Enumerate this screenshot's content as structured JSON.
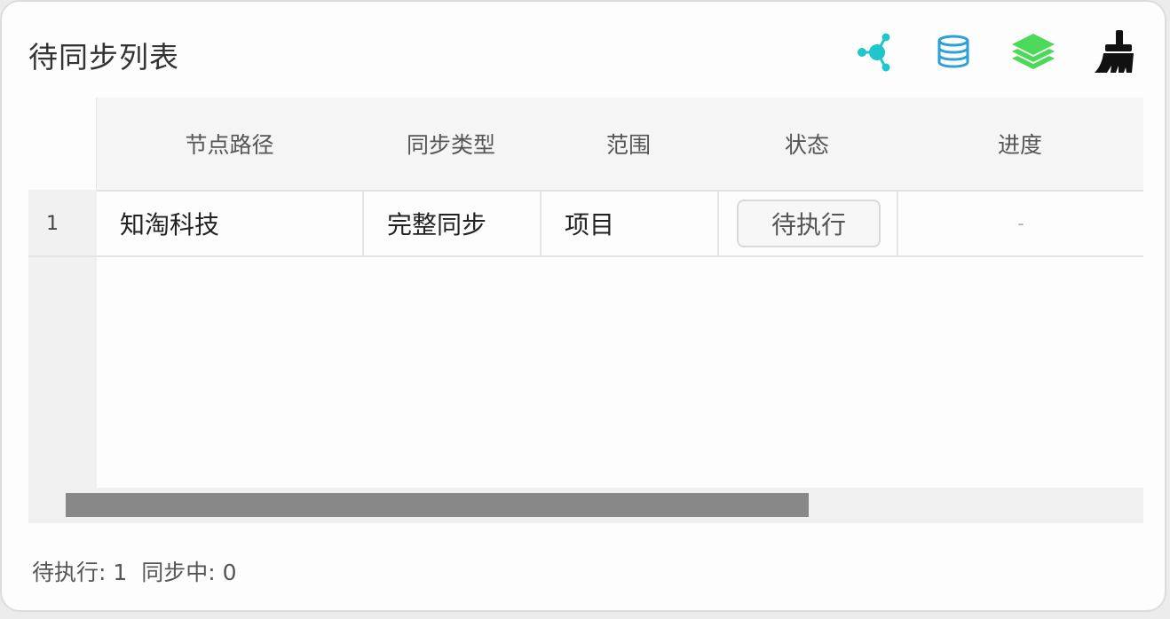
{
  "panel": {
    "title": "待同步列表"
  },
  "toolbar": {
    "icons": [
      {
        "name": "network-icon",
        "color": "#1fc7cc"
      },
      {
        "name": "database-icon",
        "color": "#2a9fd8"
      },
      {
        "name": "layers-icon",
        "color": "#4cd95a"
      },
      {
        "name": "broom-icon",
        "color": "#111111"
      }
    ]
  },
  "table": {
    "columns": [
      "节点路径",
      "同步类型",
      "范围",
      "状态",
      "进度"
    ],
    "rows": [
      {
        "index": "1",
        "path": "知淘科技",
        "sync_type": "完整同步",
        "scope": "项目",
        "status": "待执行",
        "progress": "-"
      }
    ]
  },
  "footer": {
    "pending": "待执行: 1",
    "syncing": "同步中: 0"
  },
  "colors": {
    "panel_bg": "#fdfdfd",
    "header_bg": "#f5f5f5",
    "scroll_thumb": "#888888"
  }
}
